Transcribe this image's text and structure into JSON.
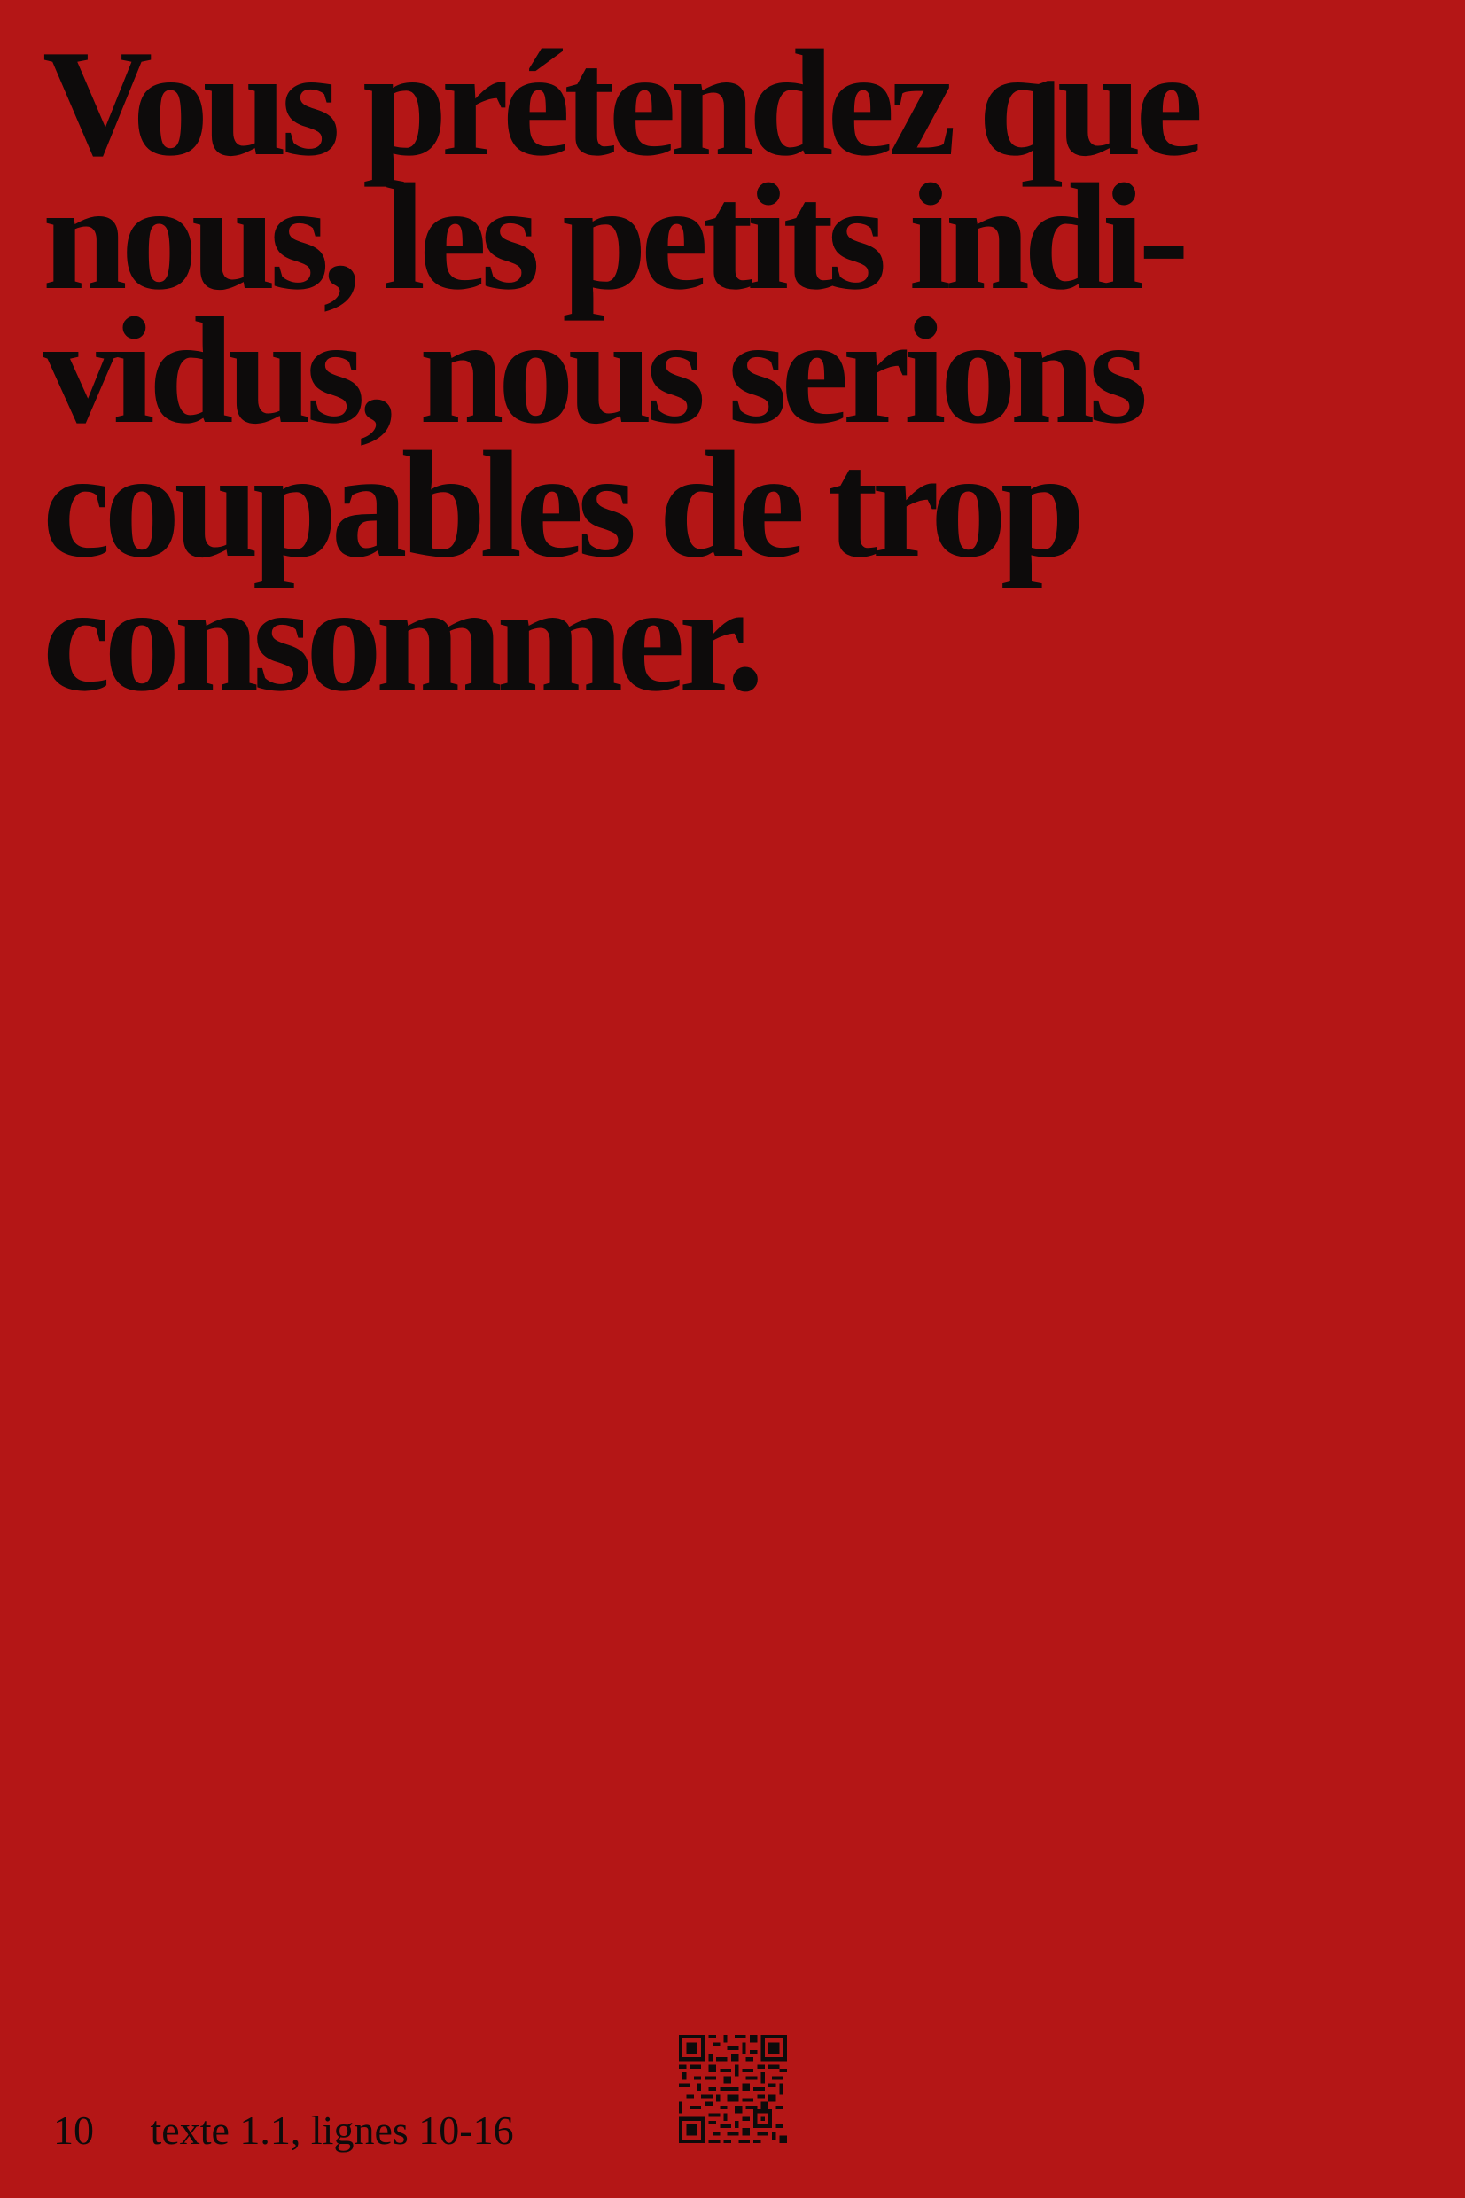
{
  "headline": {
    "lines": [
      "Vous prétendez que",
      "nous, les petits  indi-",
      "vidus, nous serions",
      "coupables de trop",
      "consommer."
    ]
  },
  "footer": {
    "page_number": "10",
    "reference": "texte 1.1, lignes 10-16"
  },
  "colors": {
    "background": "#b41616",
    "text": "#0d0b0b"
  },
  "icons": {
    "qr_code": "qr-code-icon"
  }
}
